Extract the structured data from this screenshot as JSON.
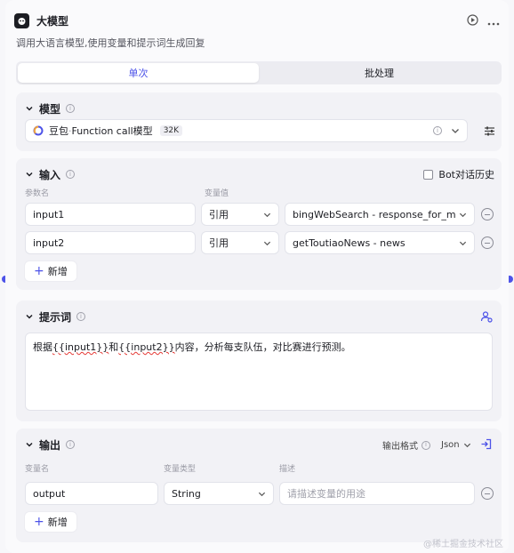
{
  "header": {
    "title": "大模型",
    "description": "调用大语言模型,使用变量和提示词生成回复"
  },
  "tabs": [
    {
      "label": "单次",
      "active": true
    },
    {
      "label": "批处理",
      "active": false
    }
  ],
  "model": {
    "title": "模型",
    "provider": "豆包",
    "name": "Function call模型",
    "context_badge": "32K"
  },
  "input": {
    "title": "输入",
    "history_label": "Bot对话历史",
    "col_param": "参数名",
    "col_value": "变量值",
    "rows": [
      {
        "name": "input1",
        "mode": "引用",
        "value": "bingWebSearch - response_for_m..."
      },
      {
        "name": "input2",
        "mode": "引用",
        "value": "getToutiaoNews - news"
      }
    ],
    "add_label": "新增"
  },
  "prompt": {
    "title": "提示词",
    "text_before": "根据",
    "var1": "{{input1}}",
    "text_mid": "和",
    "var2": "{{input2}}",
    "text_after": "内容，分析每支队伍，对比赛进行预测。"
  },
  "output": {
    "title": "输出",
    "format_label": "输出格式",
    "format_value": "Json",
    "col_name": "变量名",
    "col_type": "变量类型",
    "col_desc": "描述",
    "rows": [
      {
        "name": "output",
        "type": "String",
        "desc_placeholder": "请描述变量的用途"
      }
    ],
    "add_label": "新增"
  },
  "watermark": "@稀土掘金技术社区",
  "colors": {
    "accent": "#4d53e8",
    "danger": "#e53935"
  }
}
